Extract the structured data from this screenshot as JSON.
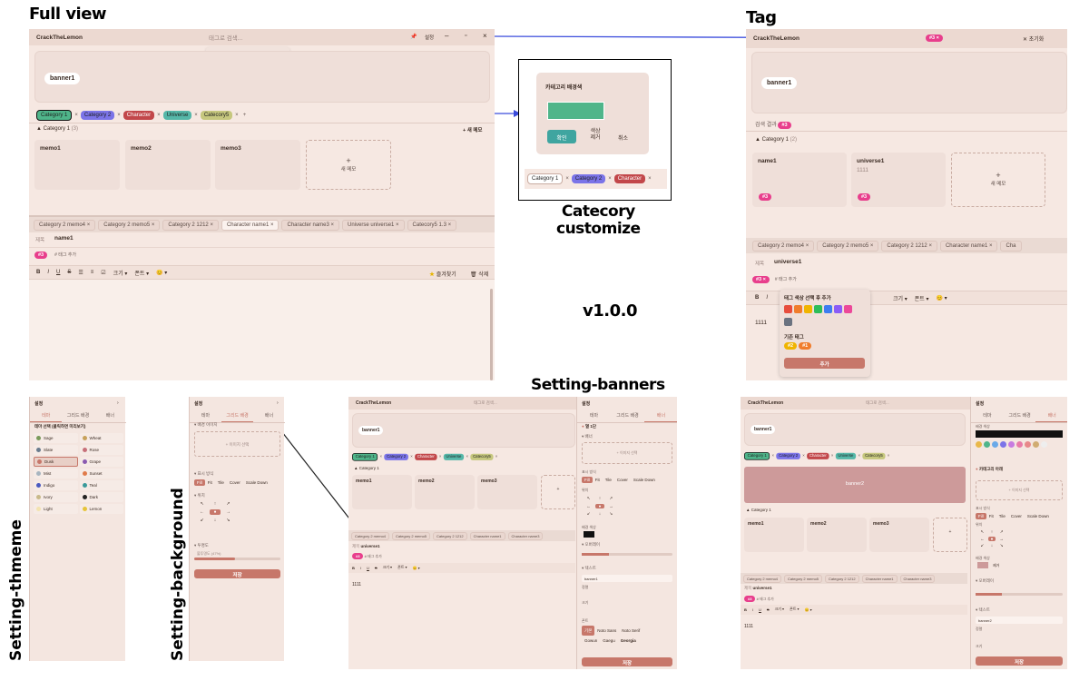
{
  "headings": {
    "full_view": "Full view",
    "tag": "Tag",
    "category_customize_1": "Catecory",
    "category_customize_2": "customize",
    "version": "v1.0.0",
    "setting_banners": "Setting-banners",
    "setting_theme": "Setting-thmeme",
    "setting_background": "Setting-background"
  },
  "app": {
    "title": "CrackTheLemon",
    "search_placeholder": "태그로 검색...",
    "settings_label": "설정"
  },
  "search_suggestions": [
    "#3",
    "#2",
    "#1"
  ],
  "banner": {
    "name": "banner1",
    "name2": "banner2"
  },
  "categories": [
    {
      "label": "Category 1",
      "color": "#4fb58a"
    },
    {
      "label": "Category 2",
      "color": "#7b74e8"
    },
    {
      "label": "Character",
      "color": "#c2474a"
    },
    {
      "label": "Universe",
      "color": "#55b7a8"
    },
    {
      "label": "Catecory5",
      "color": "#c6c77e"
    }
  ],
  "section": {
    "title": "Category 1",
    "count": "(3)",
    "new_memo": "+ 새 메모",
    "new_memo_card": "새 메모",
    "plus": "+"
  },
  "memos": [
    "memo1",
    "memo2",
    "memo3"
  ],
  "tabs": [
    {
      "label": "Category 2  memo4"
    },
    {
      "label": "Category 2  memo5"
    },
    {
      "label": "Category 2  1212"
    },
    {
      "label": "Character  name1"
    },
    {
      "label": "Character  name3"
    },
    {
      "label": "Universe  universe1"
    },
    {
      "label": "Catecory5  1.3"
    }
  ],
  "editor": {
    "title_label": "제목",
    "title_value": "name1",
    "tag_placeholder": "# 태그 추가",
    "tag": "#3",
    "toolbar": {
      "bold": "B",
      "italic": "I",
      "underline": "U",
      "strike": "S",
      "size": "크기 ▾",
      "font": "폰트 ▾",
      "emoji": "😊 ▾",
      "favorite": "즐겨찾기",
      "delete": "삭제"
    }
  },
  "category_popup": {
    "title": "카테고리 배경색",
    "confirm": "확인",
    "remove": "색상\n제거",
    "cancel": "취소",
    "swatch_color": "#4fb58a",
    "input_value": "Category 1"
  },
  "tag_view": {
    "title": "CrackTheLemon",
    "active_tag": "#3",
    "reset": "✕ 초기화",
    "search_result_label": "검색 결과",
    "search_result_tag": "#3",
    "section_title": "Category 1",
    "section_count": "(2)",
    "cards": [
      {
        "title": "name1",
        "sub": "",
        "tag": "#3"
      },
      {
        "title": "universe1",
        "sub": "1111",
        "tag": "#3"
      }
    ],
    "new_memo": "새 메모",
    "editor_title": "universe1",
    "tag_placeholder": "# 태그 추가",
    "body_text": "1111",
    "tabs": [
      "Category 2  memo4",
      "Category 2  memo5",
      "Category 2  1212",
      "Character  name1",
      "Cha"
    ]
  },
  "tag_popup": {
    "title": "태그 색상 선택 후 추가",
    "existing_label": "기존 태그",
    "existing": [
      "#2",
      "#1"
    ],
    "add": "추가",
    "colors": [
      "#e74c3c",
      "#f07c2b",
      "#f0b400",
      "#2ebd59",
      "#3d7cf0",
      "#8b5cf6",
      "#ec4899",
      "#6b7280"
    ]
  },
  "settings": {
    "title": "설정",
    "tabs": [
      "테마",
      "그리드 배경",
      "배너"
    ],
    "theme_section": "테마 선택 (클릭하면 미리보기)",
    "themes": [
      {
        "name": "Sage",
        "color": "#7a9a5a"
      },
      {
        "name": "Wheat",
        "color": "#c7a15a"
      },
      {
        "name": "Slate",
        "color": "#6a7c8e"
      },
      {
        "name": "Rose",
        "color": "#c7707a"
      },
      {
        "name": "Dusk",
        "color": "#c7776a"
      },
      {
        "name": "Grape",
        "color": "#8a5ab0"
      },
      {
        "name": "Mist",
        "color": "#a8b5c0"
      },
      {
        "name": "Sunset",
        "color": "#e07a4a"
      },
      {
        "name": "Indigo",
        "color": "#4a5ac0"
      },
      {
        "name": "Teal",
        "color": "#3a9a9a"
      },
      {
        "name": "Ivory",
        "color": "#c9b98a"
      },
      {
        "name": "Dark",
        "color": "#222222"
      },
      {
        "name": "Light",
        "color": "#f3e3b0"
      },
      {
        "name": "Lemon",
        "color": "#e6c43a"
      }
    ],
    "bg_section": "배경 이미지",
    "image_select": "+ 이미지 선택",
    "display_section": "표시 방식",
    "display_options": [
      "Fill",
      "Fit",
      "Tile",
      "Cover",
      "Scale Down"
    ],
    "position_section": "위치",
    "opacity_section": "투명도",
    "opacity_value": "불투명도 (47%)",
    "save": "저장",
    "banner_section": "배너",
    "color_label": "배경 색상",
    "overlay_label": "오버레이",
    "text_label": "텍스트",
    "align_label": "정렬",
    "size_label": "크기",
    "font_label": "폰트",
    "fonts": [
      "기본",
      "Noto Sans",
      "Noto Serif",
      "Gowun",
      "Gaegu",
      "Georgia"
    ],
    "banner_name": "banner1",
    "banner_name2": "banner2",
    "callout1": "열 1단",
    "callout2": "카테고리 아래",
    "remove": "제거",
    "palette": [
      "#e9b84a",
      "#4fb58a",
      "#6aa9e8",
      "#7b74e8",
      "#c77be0",
      "#e87ba8",
      "#e8888a",
      "#d0ac72",
      "#eeeeee"
    ]
  },
  "theme_view": {
    "memo_body": "1111",
    "editor_title": "universe1"
  }
}
